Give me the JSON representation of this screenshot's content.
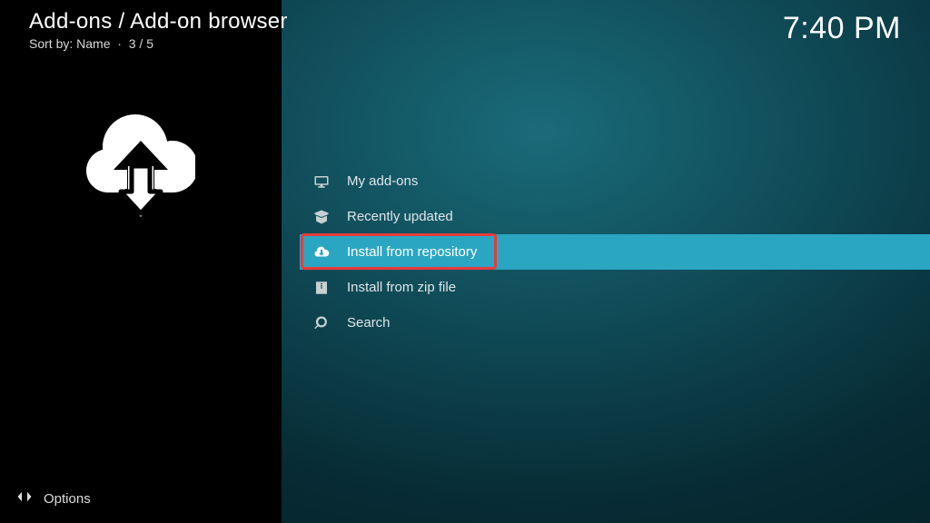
{
  "header": {
    "title": "Add-ons / Add-on browser",
    "sort_prefix": "Sort by:",
    "sort_value": "Name",
    "position": "3 / 5",
    "clock": "7:40 PM"
  },
  "menu": {
    "items": [
      {
        "label": "My add-ons",
        "icon": "monitor"
      },
      {
        "label": "Recently updated",
        "icon": "box"
      },
      {
        "label": "Install from repository",
        "icon": "cloud-down",
        "selected": true,
        "highlighted": true
      },
      {
        "label": "Install from zip file",
        "icon": "zip"
      },
      {
        "label": "Search",
        "icon": "search"
      }
    ]
  },
  "footer": {
    "options_label": "Options"
  }
}
